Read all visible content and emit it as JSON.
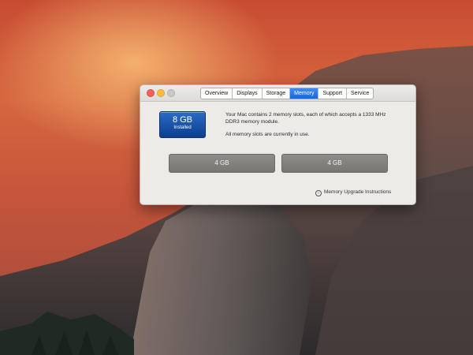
{
  "window": {
    "tabs": [
      {
        "label": "Overview",
        "active": false
      },
      {
        "label": "Displays",
        "active": false
      },
      {
        "label": "Storage",
        "active": false
      },
      {
        "label": "Memory",
        "active": true
      },
      {
        "label": "Support",
        "active": false
      },
      {
        "label": "Service",
        "active": false
      }
    ]
  },
  "memory": {
    "size": "8 GB",
    "installed_label": "Installed",
    "description": "Your Mac contains 2 memory slots, each of which accepts a 1333 MHz DDR3 memory module.",
    "status": "All memory slots are currently in use.",
    "slots": [
      "4 GB",
      "4 GB"
    ],
    "upgrade_link": "Memory Upgrade Instructions"
  },
  "colors": {
    "active_tab": "#1d63d6",
    "memory_badge": "#0d3e8f",
    "slot_fill": "#7f7e7b"
  }
}
